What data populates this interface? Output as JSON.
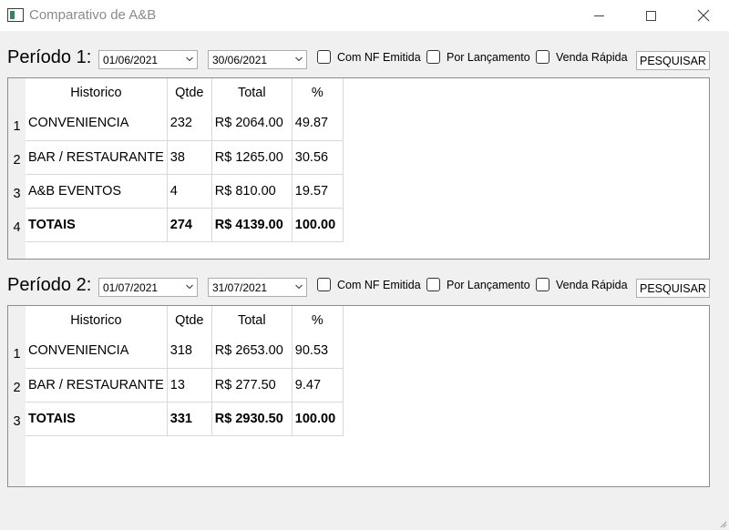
{
  "window": {
    "title": "Comparativo de A&B"
  },
  "periods": [
    {
      "label": "Período 1:",
      "date_from": "01/06/2021",
      "date_to": "30/06/2021",
      "checks": {
        "nf": "Com NF Emitida",
        "lancamento": "Por Lançamento",
        "venda": "Venda Rápida"
      },
      "search_label": "PESQUISAR",
      "headers": [
        "Historico",
        "Qtde",
        "Total",
        "%"
      ],
      "rows": [
        {
          "n": "1",
          "historico": "CONVENIENCIA",
          "qtde": "232",
          "total": "R$ 2064.00",
          "pct": "49.87"
        },
        {
          "n": "2",
          "historico": "BAR / RESTAURANTE",
          "qtde": "38",
          "total": "R$ 1265.00",
          "pct": "30.56"
        },
        {
          "n": "3",
          "historico": "A&B EVENTOS",
          "qtde": "4",
          "total": "R$ 810.00",
          "pct": "19.57"
        },
        {
          "n": "4",
          "historico": "TOTAIS",
          "qtde": "274",
          "total": "R$ 4139.00",
          "pct": "100.00"
        }
      ]
    },
    {
      "label": "Período 2:",
      "date_from": "01/07/2021",
      "date_to": "31/07/2021",
      "checks": {
        "nf": "Com NF Emitida",
        "lancamento": "Por Lançamento",
        "venda": "Venda Rápida"
      },
      "search_label": "PESQUISAR",
      "headers": [
        "Historico",
        "Qtde",
        "Total",
        "%"
      ],
      "rows": [
        {
          "n": "1",
          "historico": "CONVENIENCIA",
          "qtde": "318",
          "total": "R$ 2653.00",
          "pct": "90.53"
        },
        {
          "n": "2",
          "historico": "BAR / RESTAURANTE",
          "qtde": "13",
          "total": "R$ 277.50",
          "pct": "9.47"
        },
        {
          "n": "3",
          "historico": "TOTAIS",
          "qtde": "331",
          "total": "R$ 2930.50",
          "pct": "100.00"
        }
      ]
    }
  ]
}
